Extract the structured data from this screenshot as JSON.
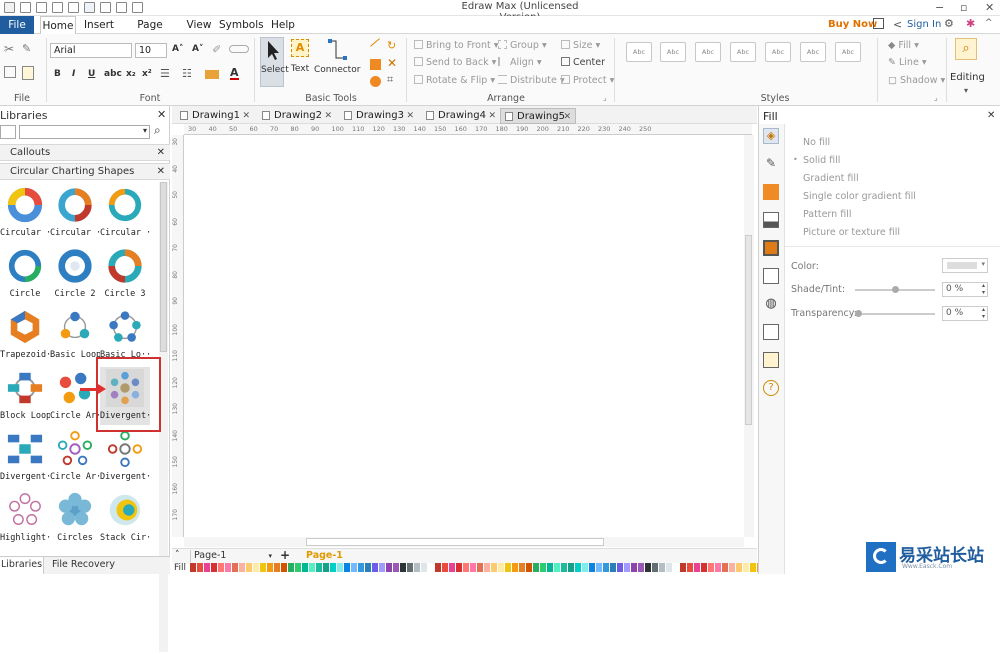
{
  "window": {
    "title": "Edraw Max (Unlicensed Version)"
  },
  "menu": {
    "tabs": [
      "File",
      "Home",
      "Insert",
      "Page Layout",
      "View",
      "Symbols",
      "Help"
    ],
    "buy_now": "Buy Now",
    "sign_in": "Sign In"
  },
  "ribbon": {
    "groups": {
      "file": "File",
      "font": "Font",
      "basic_tools": "Basic Tools",
      "arrange": "Arrange",
      "styles": "Styles"
    },
    "font_name": "Arial",
    "font_size": "10",
    "tools": {
      "select": "Select",
      "text": "Text",
      "connector": "Connector"
    },
    "arrange": {
      "bring_front": "Bring to Front",
      "send_back": "Send to Back",
      "rotate": "Rotate & Flip",
      "group": "Group",
      "align": "Align",
      "distribute": "Distribute",
      "size": "Size",
      "center": "Center",
      "protect": "Protect"
    },
    "style_box": "Abc",
    "fill_tools": {
      "fill": "Fill",
      "line": "Line",
      "shadow": "Shadow"
    },
    "editing": "Editing"
  },
  "libraries": {
    "title": "Libraries",
    "sections": [
      "Callouts",
      "Circular Charting Shapes"
    ],
    "shapes": [
      {
        "label": "Circular ···"
      },
      {
        "label": "Circular ···"
      },
      {
        "label": "Circular ···"
      },
      {
        "label": "Circle"
      },
      {
        "label": "Circle 2"
      },
      {
        "label": "Circle 3"
      },
      {
        "label": "Trapezoid···"
      },
      {
        "label": "Basic Loop"
      },
      {
        "label": "Basic Lo···"
      },
      {
        "label": "Block Loop"
      },
      {
        "label": "Circle Ar···"
      },
      {
        "label": "Divergent···"
      },
      {
        "label": "Divergent···"
      },
      {
        "label": "Circle Ar···"
      },
      {
        "label": "Divergent···"
      },
      {
        "label": "Highlight···"
      },
      {
        "label": "Circles"
      },
      {
        "label": "Stack Cir···"
      }
    ],
    "bottom_tabs": [
      "Libraries",
      "File Recovery"
    ]
  },
  "drawing_tabs": [
    "Drawing1",
    "Drawing2",
    "Drawing3",
    "Drawing4",
    "Drawing5"
  ],
  "ruler_h": [
    "30",
    "40",
    "50",
    "60",
    "70",
    "80",
    "90",
    "100",
    "110",
    "120",
    "130",
    "140",
    "150",
    "160",
    "170",
    "180",
    "190",
    "200",
    "210",
    "220",
    "230",
    "240",
    "250"
  ],
  "ruler_v": [
    "30",
    "40",
    "50",
    "60",
    "70",
    "80",
    "90",
    "100",
    "110",
    "120",
    "130",
    "140",
    "150",
    "160",
    "170"
  ],
  "status": {
    "page_select": "Page-1",
    "page_tab": "Page-1",
    "fill_label": "Fill"
  },
  "fill_panel": {
    "title": "Fill",
    "options": [
      "No fill",
      "Solid fill",
      "Gradient fill",
      "Single color gradient fill",
      "Pattern fill",
      "Picture or texture fill"
    ],
    "color_label": "Color:",
    "shade_label": "Shade/Tint:",
    "shade_value": "0 %",
    "transparency_label": "Transparency:",
    "transparency_value": "0 %"
  },
  "watermark": {
    "text": "易采站长站",
    "sub": "Www.Easck.Com"
  }
}
